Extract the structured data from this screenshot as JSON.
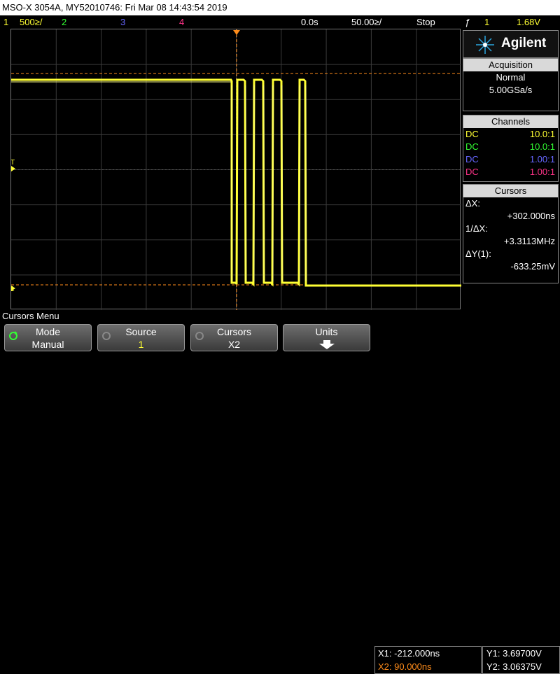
{
  "title": "MSO-X 3054A, MY52010746: Fri Mar 08 14:43:54 2019",
  "status": {
    "ch1_num": "1",
    "ch1_scale": "500≥/",
    "ch2_num": "2",
    "ch3_num": "3",
    "ch4_num": "4",
    "time_delay": "0.0s",
    "time_scale": "50.00≥/",
    "run_state": "Stop",
    "trigger_symbol": "ƒ",
    "trigger_source": "1",
    "trigger_level": "1.68V"
  },
  "brand": "Agilent",
  "acquisition": {
    "header": "Acquisition",
    "mode": "Normal",
    "rate": "5.00GSa/s"
  },
  "channels": {
    "header": "Channels",
    "rows": [
      {
        "coupling": "DC",
        "probe": "10.0:1",
        "color": "#ffff33"
      },
      {
        "coupling": "DC",
        "probe": "10.0:1",
        "color": "#33ff33"
      },
      {
        "coupling": "DC",
        "probe": "1.00:1",
        "color": "#6666ff"
      },
      {
        "coupling": "DC",
        "probe": "1.00:1",
        "color": "#ff3388"
      }
    ]
  },
  "cursors": {
    "header": "Cursors",
    "dx_label": "ΔX:",
    "dx_value": "+302.000ns",
    "inv_dx_label": "1/ΔX:",
    "inv_dx_value": "+3.3113MHz",
    "dy_label": "ΔY(1):",
    "dy_value": "-633.25mV"
  },
  "scope": {
    "trigger_marker": "T",
    "ground_marker": "1"
  },
  "menu_title": "Cursors Menu",
  "softkeys": [
    {
      "title": "Mode",
      "value": "Manual"
    },
    {
      "title": "Source",
      "value": "1"
    },
    {
      "title": "Cursors",
      "value": "X2"
    },
    {
      "title": "Units",
      "value": ""
    }
  ],
  "readout": {
    "x1": "X1: -212.000ns",
    "x2": "X2: 90.000ns",
    "y1": "Y1: 3.69700V",
    "y2": "Y2: 3.06375V"
  },
  "colors": {
    "ch1": "#ffff33",
    "ch2": "#33ff33",
    "ch3": "#6666ff",
    "ch4": "#ff3388",
    "cursor": "#ff8c1a",
    "panel_head": "#d9d9d9"
  }
}
